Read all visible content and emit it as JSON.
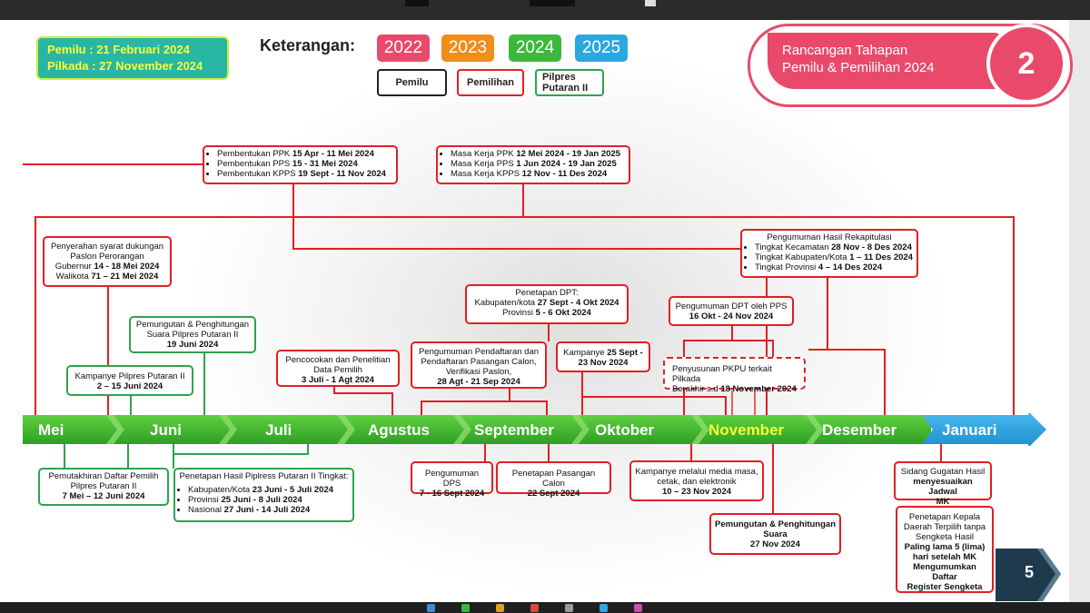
{
  "header": {
    "dates_line1": "Pemilu : 21 Februari 2024",
    "dates_line2": "Pilkada : 27 November 2024",
    "keterangan_label": "Keterangan:",
    "years": [
      {
        "label": "2022",
        "color": "#e94a6b"
      },
      {
        "label": "2023",
        "color": "#f28c1a"
      },
      {
        "label": "2024",
        "color": "#3db83a"
      },
      {
        "label": "2025",
        "color": "#2ba8e0"
      }
    ],
    "legend": [
      {
        "label": "Pemilu",
        "border": "#222222"
      },
      {
        "label": "Pemilihan",
        "border": "#e31e24"
      },
      {
        "label": "Pilpres Putaran II",
        "border": "#2da44e"
      }
    ],
    "badge_title_line1": "Rancangan Tahapan",
    "badge_title_line2": "Pemilu & Pemilihan 2024",
    "badge_number": "2",
    "page_number": "5"
  },
  "timeline": {
    "months": [
      "Mei",
      "Juni",
      "Juli",
      "Agustus",
      "September",
      "Oktober",
      "November",
      "Desember",
      "Januari"
    ],
    "highlight_month": "November",
    "colors": {
      "green": "#3db83a",
      "blue": "#2ba8e0",
      "highlight": "#f5ff3a",
      "red": "#e31e24"
    }
  },
  "boxes": {
    "pembentukan": {
      "l1a": "Pembentukan PPK ",
      "l1b": "15 Apr - 11 Mei 2024",
      "l2a": "Pembentukan PPS ",
      "l2b": "15 - 31 Mei 2024",
      "l3a": "Pembentukan KPPS ",
      "l3b": "19 Sept - 11 Nov 2024"
    },
    "masa_kerja": {
      "l1a": "Masa Kerja PPK ",
      "l1b": "12 Mei 2024 - 19 Jan 2025",
      "l2a": "Masa Kerja PPS ",
      "l2b": "1 Jun 2024 - 19 Jan 2025",
      "l3a": "Masa Kerja KPPS ",
      "l3b": "12 Nov - 11 Des 2024"
    },
    "penyerahan": {
      "l1": "Penyerahan syarat dukungan",
      "l2": "Paslon Perorangan",
      "l3a": "Gubernur ",
      "l3b": "14 - 18 Mei 2024",
      "l4a": "Walikota ",
      "l4b": "71 – 21 Mei 2024"
    },
    "rekap": {
      "title": "Pengumuman Hasil Rekapitulasi",
      "l1a": "Tingkat Kecamatan ",
      "l1b": "28 Nov - 8 Des 2024",
      "l2a": "Tingkat Kabupaten/Kota ",
      "l2b": "1 – 11 Des 2024",
      "l3a": "Tingkat Provinsi ",
      "l3b": "4 – 14 Des 2024"
    },
    "pemungutan_pilpres": {
      "l1": "Pemungutan & Penghitungan",
      "l2": "Suara Pilpres Putaran II",
      "l3": "19 Juni 2024"
    },
    "penetapan_dpt": {
      "title": "Penetapan DPT:",
      "l1a": "Kabupaten/kota ",
      "l1b": "27 Sept - 4 Okt 2024",
      "l2a": "Provinsi ",
      "l2b": "5 - 6 Okt 2024"
    },
    "pengumuman_dpt": {
      "l1": "Pengumuman DPT oleh PPS",
      "l2": "16 Okt - 24 Nov 2024"
    },
    "pencocokan": {
      "l1": "Pencocokan dan Penelitian",
      "l2": "Data Pemilih",
      "l3": "3 Juli - 1 Agt 2024"
    },
    "pendaftaran": {
      "l1": "Pengumuman Pendaftaran dan",
      "l2": "Pendaftaran  Pasangan Calon,",
      "l3": "Verifikasi Paslon,",
      "l4": "28 Agt - 21 Sep 2024"
    },
    "kampanye": {
      "l1a": "Kampanye ",
      "l1b": "25 Sept -",
      "l2": "23 Nov 2024"
    },
    "penyusunan": {
      "l1": "Penyusunan PKPU terkait Pilkada",
      "l2a": "Berakhir s.d ",
      "l2b": "18 November 2024"
    },
    "kampanye_pilpres": {
      "l1": "Kampanye Pilpres Putaran II",
      "l2": "2 – 15 Juni 2024"
    },
    "pemutakhiran": {
      "l1": "Pemutakhiran Daftar Pemilih",
      "l2": "Pilpres Putaran II",
      "l3": "7 Mei – 12 Juni 2024"
    },
    "penetapan_hasil": {
      "title": "Penetapan Hasil Piplress Putaran II Tingkat:",
      "l1a": "Kabupaten/Kota ",
      "l1b": "23 Juni - 5 Juli 2024",
      "l2a": "Provinsi ",
      "l2b": "25 Juni - 8 Juli 2024",
      "l3a": "Nasional ",
      "l3b": "27 Juni - 14 Juli 2024"
    },
    "pengumuman_dps": {
      "l1": "Pengumuman DPS",
      "l2": "7 - 16 Sept 2024"
    },
    "penetapan_paslon": {
      "l1": "Penetapan Pasangan Calon",
      "l2": "22 Sept 2024"
    },
    "kampanye_media": {
      "l1": "Kampanye melalui media masa,",
      "l2": "cetak, dan elektronik",
      "l3": "10 – 23 Nov 2024"
    },
    "pemungutan_pilkada": {
      "l1": "Pemungutan & Penghitungan",
      "l2": "Suara",
      "l3": "27 Nov 2024"
    },
    "sidang": {
      "l1": "Sidang Gugatan Hasil",
      "l2": "menyesuaikan Jadwal",
      "l3": "MK"
    },
    "penetapan_kepala": {
      "l1": "Penetapan Kepala",
      "l2": "Daerah Terpilih  tanpa",
      "l3": "Sengketa Hasil",
      "l4": "Paling lama 5 (lima)",
      "l5": "hari setelah MK",
      "l6": "Mengumumkan Daftar",
      "l7": "Register Sengketa"
    }
  }
}
